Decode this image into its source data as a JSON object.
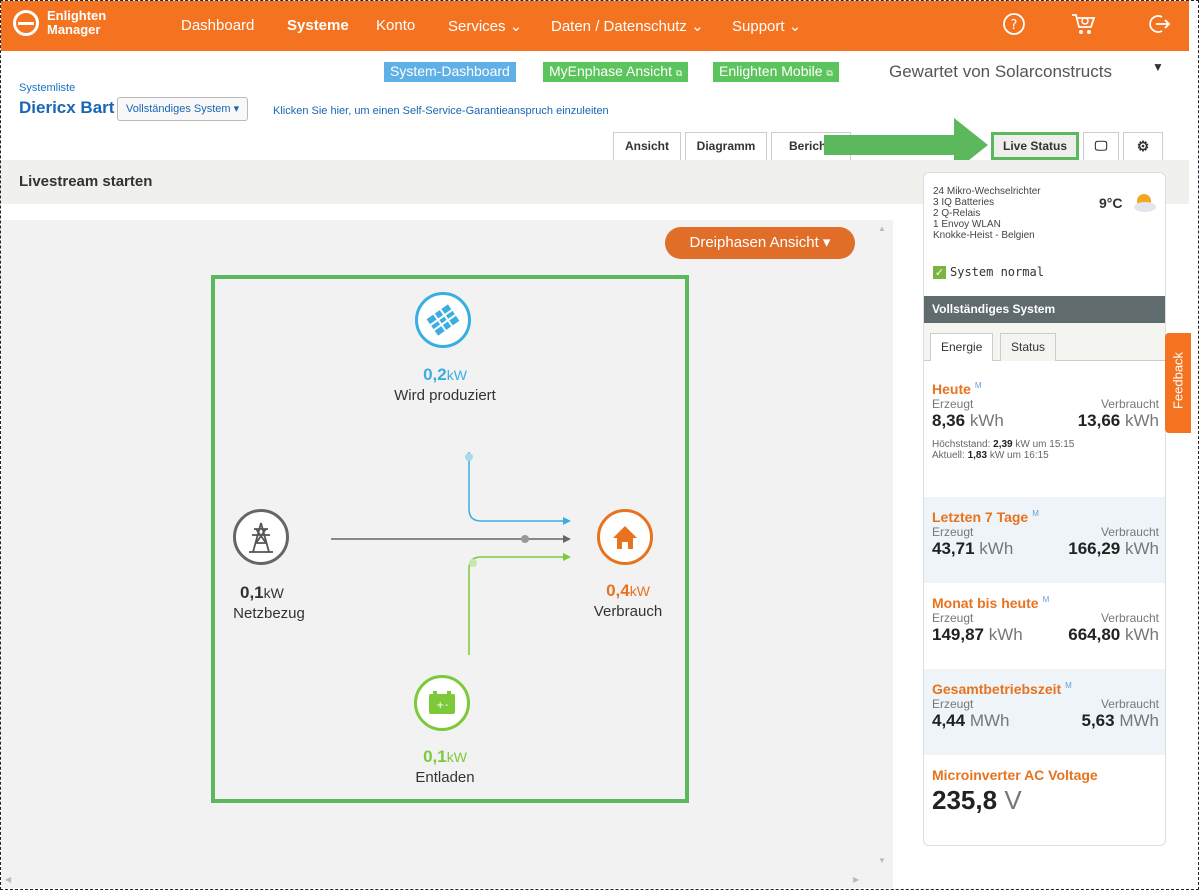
{
  "brand": {
    "line1": "Enlighten",
    "line2": "Manager"
  },
  "nav": {
    "dashboard": "Dashboard",
    "systeme": "Systeme",
    "konto": "Konto",
    "services": "Services ⌄",
    "daten": "Daten / Datenschutz ⌄",
    "support": "Support ⌄"
  },
  "pills": {
    "dashboard": "System-Dashboard",
    "myenphase": "MyEnphase Ansicht",
    "mobile": "Enlighten Mobile"
  },
  "maintained": "Gewartet von Solarconstructs",
  "breadcrumb": "Systemliste",
  "system_name": "Diericx Bart",
  "system_dropdown": "Vollständiges System ▾",
  "claim_link": "Klicken Sie hier, um einen Self-Service-Garantieanspruch einzuleiten",
  "tabs": {
    "ansicht": "Ansicht",
    "diagramm": "Diagramm",
    "berichte": "Berichte",
    "live": "Live Status"
  },
  "stream_title": "Livestream starten",
  "phase_button": "Dreiphasen Ansicht ▾",
  "flow": {
    "production": {
      "value": "0,2",
      "unit": "kW",
      "label": "Wird produziert"
    },
    "grid": {
      "value": "0,1",
      "unit": "kW",
      "label": "Netzbezug"
    },
    "consumption": {
      "value": "0,4",
      "unit": "kW",
      "label": "Verbrauch"
    },
    "battery": {
      "value": "0,1",
      "unit": "kW",
      "label": "Entladen"
    }
  },
  "panel": {
    "info": [
      "24 Mikro-Wechselrichter",
      "3 IQ Batteries",
      "2 Q-Relais",
      "1 Envoy  WLAN",
      "Knokke-Heist - Belgien"
    ],
    "temperature": "9°C",
    "status": "System normal",
    "section": "Vollständiges System",
    "tab_energy": "Energie",
    "tab_status": "Status",
    "lbl_prod": "Erzeugt",
    "lbl_cons": "Verbraucht",
    "today": {
      "title": "Heute",
      "badge": "M",
      "prod": "8,36",
      "prod_unit": "kWh",
      "cons": "13,66",
      "cons_unit": "kWh",
      "peak_label": "Höchststand:",
      "peak": "2,39",
      "peak_unit": "kW um 15:15",
      "now_label": "Aktuell:",
      "now": "1,83",
      "now_unit": "kW um 16:15"
    },
    "week": {
      "title": "Letzten 7 Tage",
      "badge": "M",
      "prod": "43,71",
      "prod_unit": "kWh",
      "cons": "166,29",
      "cons_unit": "kWh"
    },
    "month": {
      "title": "Monat bis heute",
      "badge": "M",
      "prod": "149,87",
      "prod_unit": "kWh",
      "cons": "664,80",
      "cons_unit": "kWh"
    },
    "total": {
      "title": "Gesamtbetriebszeit",
      "badge": "M",
      "prod": "4,44",
      "prod_unit": "MWh",
      "cons": "5,63",
      "cons_unit": "MWh"
    },
    "voltage": {
      "title": "Microinverter AC Voltage",
      "value": "235,8",
      "unit": "V"
    }
  },
  "feedback": "Feedback",
  "colors": {
    "brand": "#f37321",
    "highlight": "#5cb85c",
    "solar": "#3aaee0",
    "battery": "#7cc93a",
    "home": "#e8731f",
    "grid": "#666666"
  }
}
